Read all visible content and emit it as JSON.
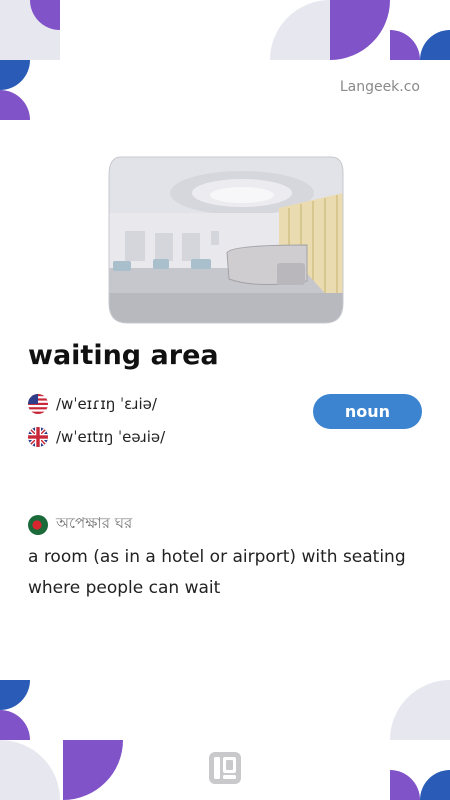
{
  "site": {
    "brand": "Langeek.co"
  },
  "word": {
    "title": "waiting area",
    "part_of_speech": "noun"
  },
  "pronunciations": [
    {
      "accent_icon": "us-flag-icon",
      "ipa": "/wˈeɪɾɪŋ ˈɛɹiə/"
    },
    {
      "accent_icon": "uk-flag-icon",
      "ipa": "/wˈeɪtɪŋ ˈeəɹiə/"
    }
  ],
  "translation": {
    "flag_icon": "bangladesh-flag-icon",
    "text": "অপেক্ষার ঘর"
  },
  "definition": "a room (as in a hotel or airport) with seating where people can wait",
  "colors": {
    "purple": "#8053c8",
    "blue": "#2a5cb7",
    "light_gray": "#e6e7ef",
    "badge_blue": "#3c84cf"
  },
  "icons": [
    "us-flag-icon",
    "uk-flag-icon",
    "bangladesh-flag-icon",
    "langeek-logo-icon"
  ]
}
